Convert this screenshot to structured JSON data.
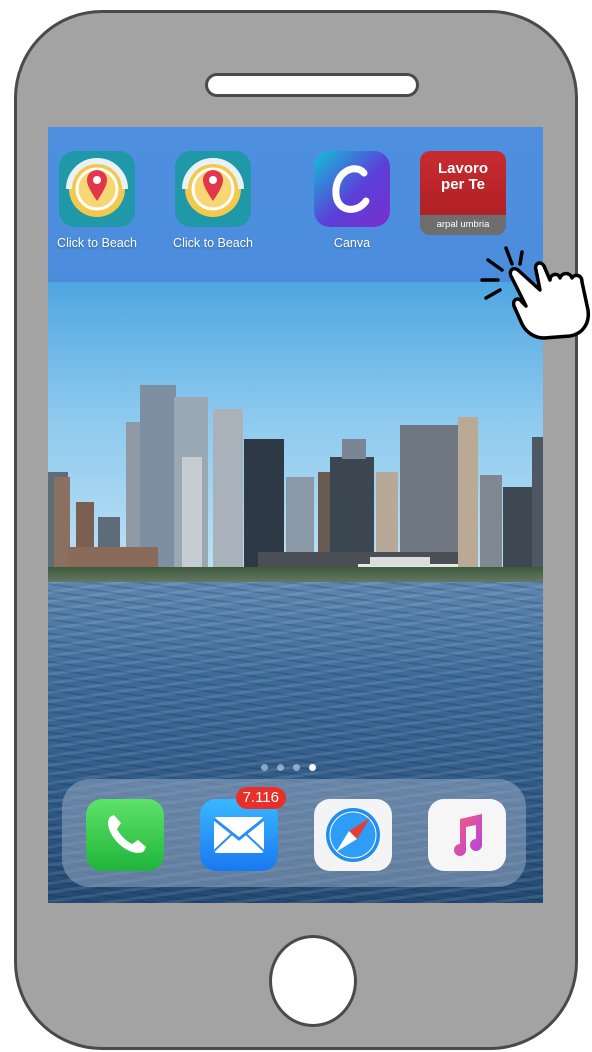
{
  "home_screen": {
    "apps": [
      {
        "label": "Click to Beach",
        "icon": "click-to-beach-icon"
      },
      {
        "label": "Click to Beach",
        "icon": "click-to-beach-icon"
      },
      {
        "label": "Canva",
        "icon": "canva-icon"
      },
      {
        "label": "",
        "icon": "lavoro-per-te-icon",
        "icon_text": {
          "line1": "Lavoro",
          "line2": "per Te",
          "sub": "arpal umbria"
        }
      }
    ],
    "page_dots": {
      "count": 4,
      "active": 4
    },
    "dock": [
      {
        "icon": "phone-icon"
      },
      {
        "icon": "mail-icon",
        "badge": "7.116"
      },
      {
        "icon": "safari-icon"
      },
      {
        "icon": "music-icon"
      }
    ]
  },
  "colors": {
    "phone_body": "#a3a3a3",
    "phone_outline": "#4a4a4a",
    "badge": "#e8302b"
  }
}
